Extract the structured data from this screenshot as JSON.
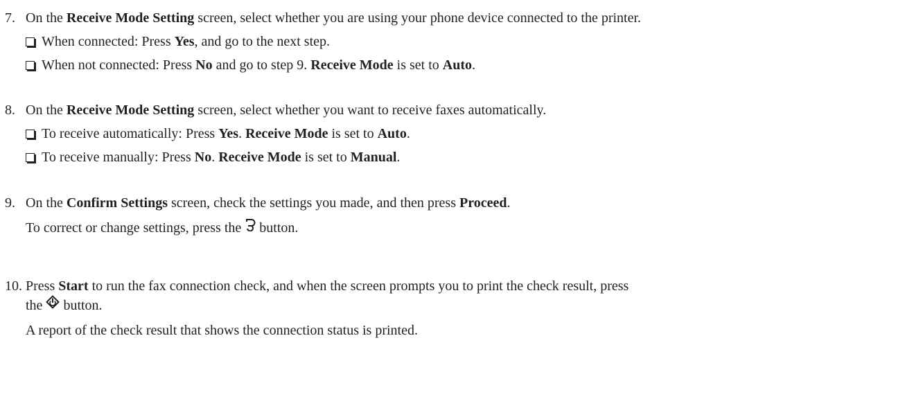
{
  "steps": [
    {
      "number": "7.",
      "main": [
        {
          "t": "On the "
        },
        {
          "t": "Receive Mode Setting",
          "b": true
        },
        {
          "t": " screen, select whether you are using your phone device connected to the printer."
        }
      ],
      "bullets": [
        [
          {
            "t": "When connected: Press "
          },
          {
            "t": "Yes",
            "b": true
          },
          {
            "t": ", and go to the next step."
          }
        ],
        [
          {
            "t": "When not connected: Press "
          },
          {
            "t": "No",
            "b": true
          },
          {
            "t": " and go to step 9. "
          },
          {
            "t": "Receive Mode",
            "b": true
          },
          {
            "t": " is set to "
          },
          {
            "t": "Auto",
            "b": true
          },
          {
            "t": "."
          }
        ]
      ]
    },
    {
      "number": "8.",
      "main": [
        {
          "t": "On the "
        },
        {
          "t": "Receive Mode Setting",
          "b": true
        },
        {
          "t": " screen, select whether you want to receive faxes automatically."
        }
      ],
      "bullets": [
        [
          {
            "t": "To receive automatically: Press "
          },
          {
            "t": "Yes",
            "b": true
          },
          {
            "t": ". "
          },
          {
            "t": "Receive Mode",
            "b": true
          },
          {
            "t": " is set to "
          },
          {
            "t": "Auto",
            "b": true
          },
          {
            "t": "."
          }
        ],
        [
          {
            "t": "To receive manually: Press "
          },
          {
            "t": "No",
            "b": true
          },
          {
            "t": ". "
          },
          {
            "t": "Receive Mode",
            "b": true
          },
          {
            "t": " is set to "
          },
          {
            "t": "Manual",
            "b": true
          },
          {
            "t": "."
          }
        ]
      ]
    },
    {
      "number": "9.",
      "main": [
        {
          "t": "On the "
        },
        {
          "t": "Confirm Settings",
          "b": true
        },
        {
          "t": " screen, check the settings you made, and then press "
        },
        {
          "t": "Proceed",
          "b": true
        },
        {
          "t": "."
        }
      ],
      "note": [
        {
          "t": "To correct or change settings, press the "
        },
        {
          "icon": "back-icon"
        },
        {
          "t": " button."
        }
      ]
    },
    {
      "number": "10.",
      "main": [
        {
          "t": "Press "
        },
        {
          "t": "Start",
          "b": true
        },
        {
          "t": " to run the fax connection check, and when the screen prompts you to print the check result, press"
        }
      ],
      "main2": [
        {
          "t": "the "
        },
        {
          "icon": "start-icon"
        },
        {
          "t": " button."
        }
      ],
      "note": [
        {
          "t": "A report of the check result that shows the connection status is printed."
        }
      ]
    }
  ]
}
